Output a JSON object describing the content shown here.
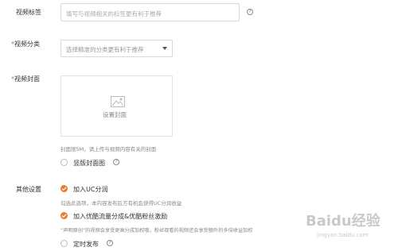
{
  "video_tags": {
    "label": "视频标签",
    "placeholder": "填写与视频相关的标签更有利于推荐"
  },
  "video_category": {
    "required_mark": "*",
    "label": "视频分类",
    "placeholder": "选择精准的分类更有利于推荐",
    "dropdown_icon": "caret-down-icon"
  },
  "video_cover": {
    "required_mark": "*",
    "label": "视频封面",
    "upload_text": "设置封面",
    "upload_icon": "image-icon",
    "hint": "封面限5M，请上传与视频内容有关的封面",
    "portrait_option": "竖版封面图"
  },
  "other_settings": {
    "label": "其他设置",
    "uc_share": {
      "label": "加入UC分润",
      "checked": true,
      "hint": "勾选此选项，本内容发布后方有机会获得UC分润收益"
    },
    "youku_share": {
      "label": "加入优酷流量分成&优酷粉丝激励",
      "checked": true,
      "hint": "“声明原创”的视频会享受更高分成加权哦，粉丝观看的视频还会享受额外的多倍收益加权"
    },
    "scheduled_publish": {
      "label": "定时发布",
      "checked": false
    }
  },
  "watermark": {
    "text": "Baidu经验",
    "sub": "jingyan.baidu.com"
  },
  "colors": {
    "accent": "#ec7a2b",
    "required": "#e8663a",
    "border": "#d9d9d9"
  }
}
